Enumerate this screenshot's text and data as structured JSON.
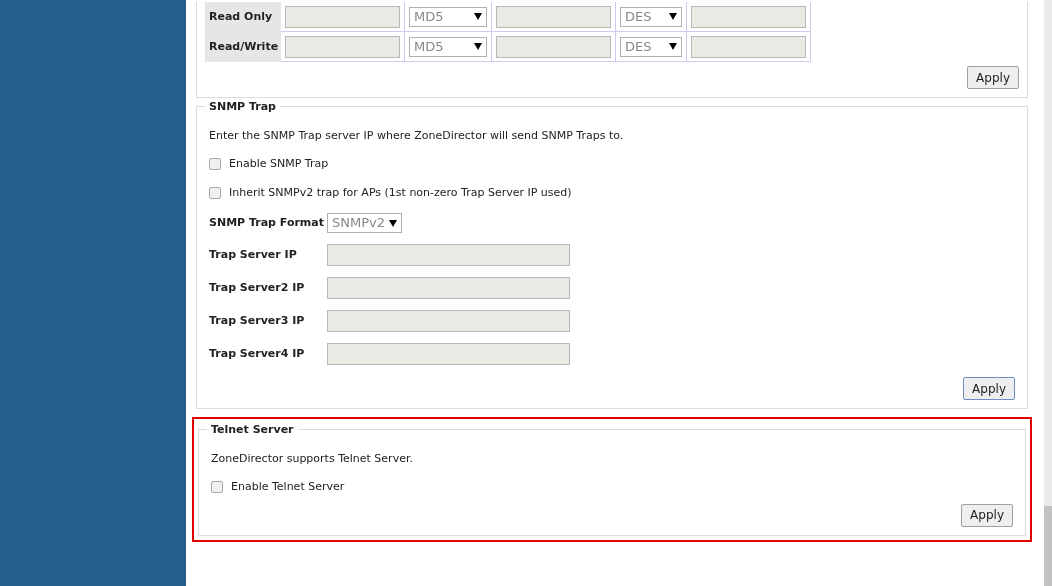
{
  "snmp_v3_rows": [
    {
      "label": "Read Only",
      "auth": "MD5",
      "privacy": "DES"
    },
    {
      "label": "Read/Write",
      "auth": "MD5",
      "privacy": "DES"
    }
  ],
  "snmp_v3_apply": "Apply",
  "snmp_trap": {
    "title": "SNMP Trap",
    "description": "Enter the SNMP Trap server IP where ZoneDirector will send SNMP Traps to.",
    "checkboxes": [
      {
        "label": "Enable SNMP Trap",
        "checked": false
      },
      {
        "label": "Inherit SNMPv2 trap for APs (1st non-zero Trap Server IP used)",
        "checked": false
      }
    ],
    "format": {
      "label": "SNMP Trap Format",
      "value": "SNMPv2"
    },
    "servers": [
      {
        "label": "Trap Server IP"
      },
      {
        "label": "Trap Server2 IP"
      },
      {
        "label": "Trap Server3 IP"
      },
      {
        "label": "Trap Server4 IP"
      }
    ],
    "apply": "Apply"
  },
  "telnet": {
    "title": "Telnet Server",
    "highlighted": true,
    "description": "ZoneDirector supports Telnet Server.",
    "checkboxes": [
      {
        "label": "Enable Telnet Server",
        "checked": false
      }
    ],
    "apply": "Apply"
  }
}
